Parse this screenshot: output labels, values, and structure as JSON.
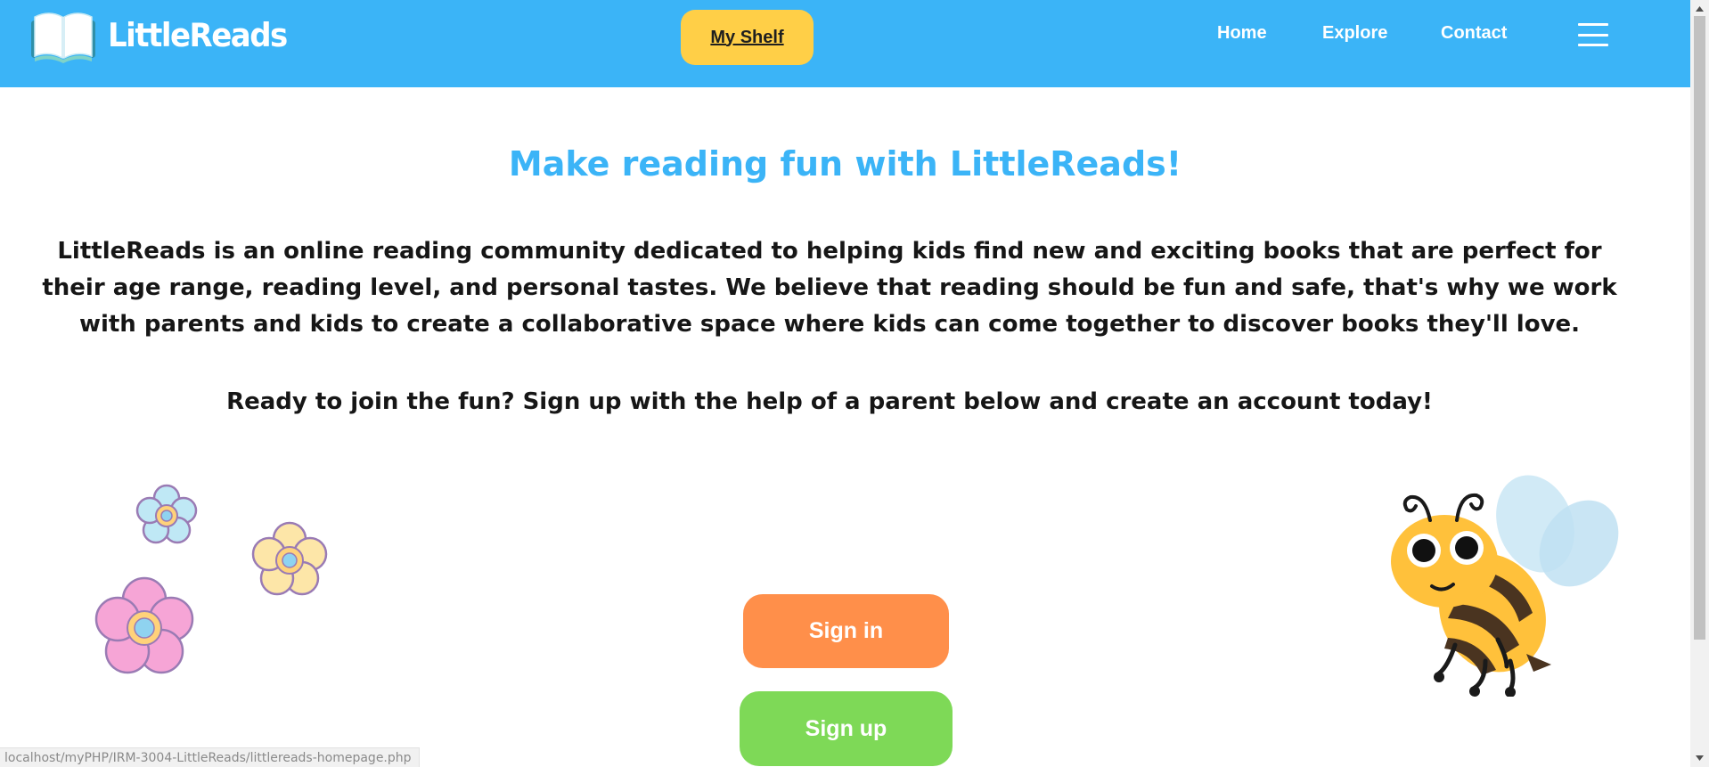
{
  "header": {
    "brand": "LittleReads",
    "shelf_button": "My Shelf",
    "nav": {
      "home": "Home",
      "explore": "Explore",
      "contact": "Contact"
    },
    "menu_icon": "hamburger-icon",
    "logo_icon": "open-book-icon"
  },
  "main": {
    "headline": "Make reading fun with LittleReads!",
    "intro": "LittleReads is an online reading community dedicated to helping kids find new and exciting books that are perfect for their age range, reading level, and personal tastes. We believe that reading should be fun and safe, that's why we work with parents and kids to create a collaborative space where kids can come together to discover books they'll love.",
    "cta": "Ready to join the fun? Sign up with the help of a parent below and create an account today!",
    "sign_in": "Sign in",
    "sign_up": "Sign up",
    "decor_left": "flowers-illustration",
    "decor_right": "bee-illustration"
  },
  "status_bar": {
    "url": "localhost/myPHP/IRM-3004-LittleReads/littlereads-homepage.php"
  },
  "colors": {
    "header_bg": "#3bb4f7",
    "shelf_button_bg": "#ffcf47",
    "headline": "#3bb4f7",
    "sign_in_bg": "#ff8f4a",
    "sign_up_bg": "#7ed957",
    "body_text": "#161616"
  }
}
